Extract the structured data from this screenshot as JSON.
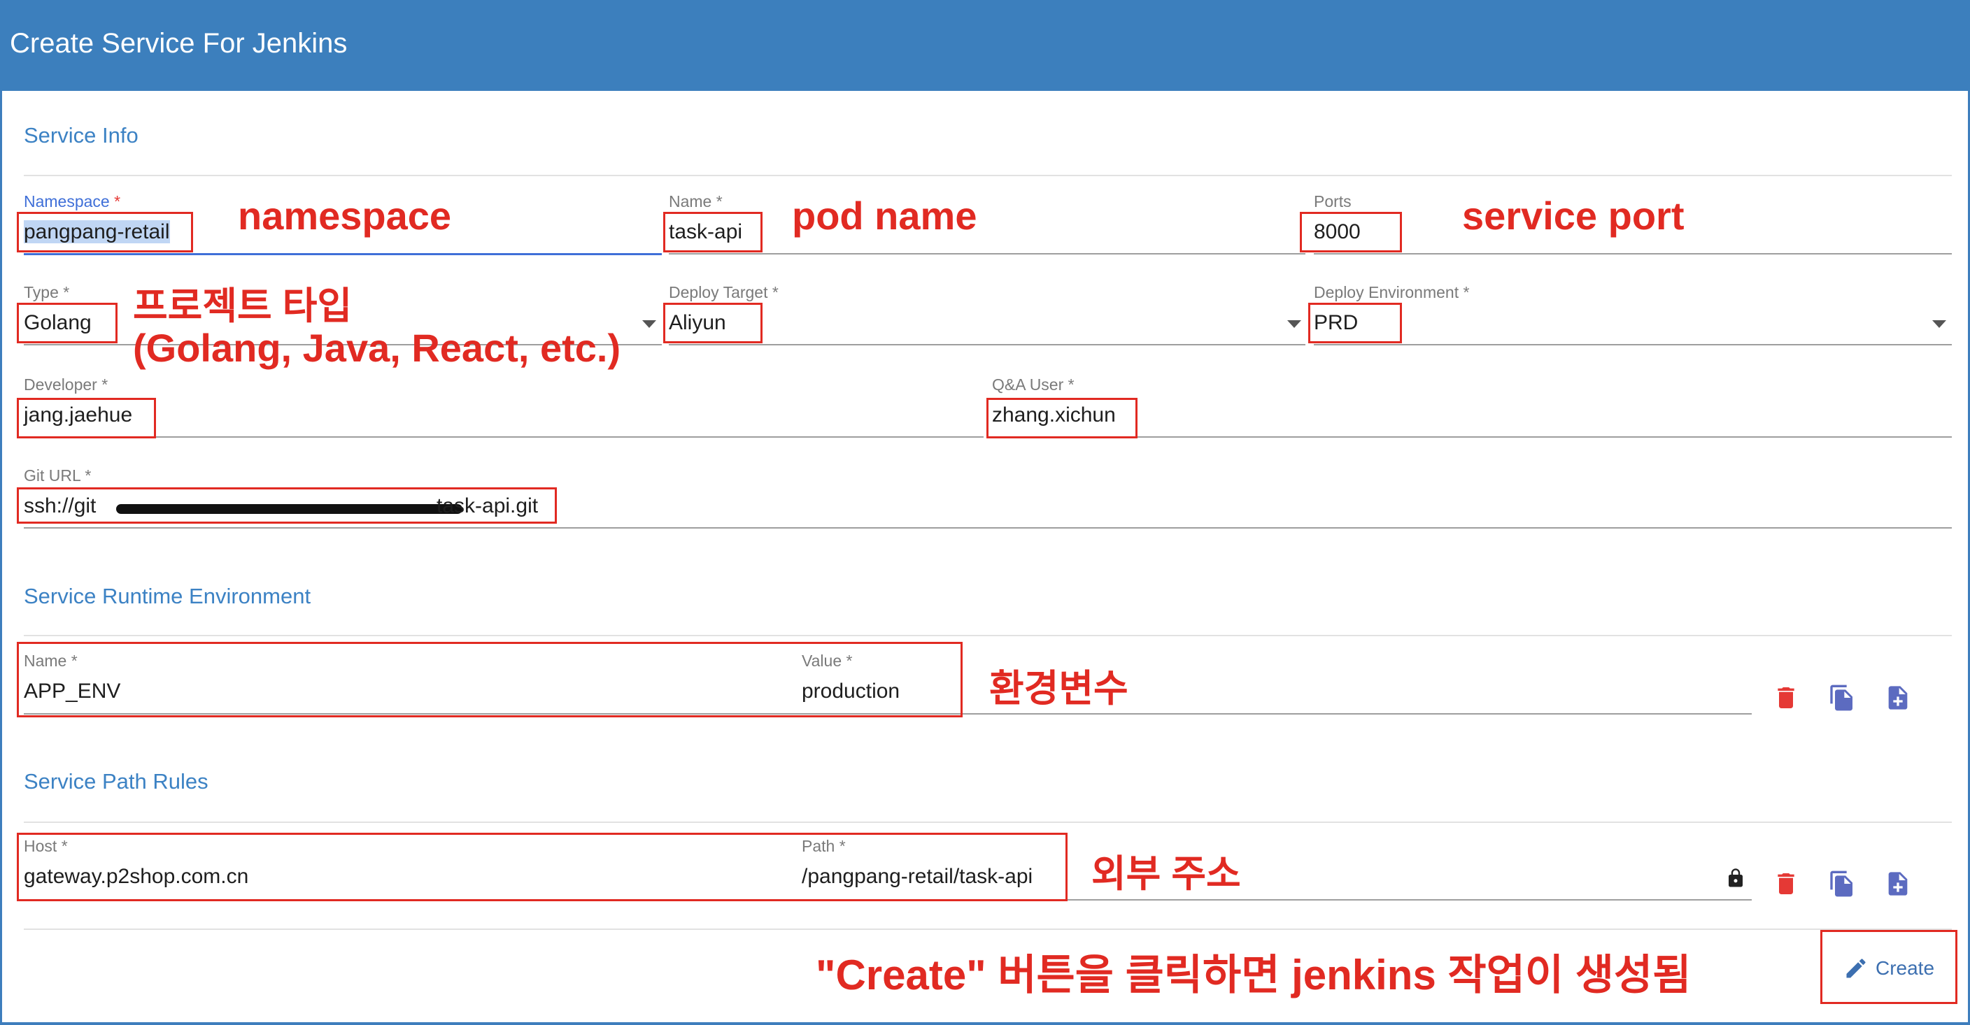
{
  "header": {
    "title": "Create Service For Jenkins"
  },
  "service_info": {
    "section_title": "Service Info",
    "namespace": {
      "label": "Namespace",
      "value": "pangpang-retail"
    },
    "name": {
      "label": "Name",
      "value": "task-api"
    },
    "ports": {
      "label": "Ports",
      "value": "8000"
    },
    "type": {
      "label": "Type",
      "value": "Golang"
    },
    "deploy_target": {
      "label": "Deploy Target",
      "value": "Aliyun"
    },
    "deploy_environment": {
      "label": "Deploy Environment",
      "value": "PRD"
    },
    "developer": {
      "label": "Developer",
      "value": "jang.jaehue"
    },
    "qa_user": {
      "label": "Q&A User",
      "value": "zhang.xichun"
    },
    "git_url": {
      "label": "Git URL",
      "value_start": "ssh://git",
      "value_end": "task-api.git"
    }
  },
  "runtime_env": {
    "section_title": "Service Runtime Environment",
    "name_label": "Name",
    "name_value": "APP_ENV",
    "value_label": "Value",
    "value_value": "production"
  },
  "path_rules": {
    "section_title": "Service Path Rules",
    "host_label": "Host",
    "host_value": "gateway.p2shop.com.cn",
    "path_label": "Path",
    "path_value": "/pangpang-retail/task-api"
  },
  "actions": {
    "create_label": "Create"
  },
  "required_mark": "*",
  "annotations": {
    "namespace": "namespace",
    "pod_name": "pod name",
    "service_port": "service port",
    "project_type_1": "프로젝트 타입",
    "project_type_2": "(Golang, Java, React, etc.)",
    "env_vars": "환경변수",
    "external_address": "외부 주소",
    "create_note": "\"Create\" 버튼을 클릭하면 jenkins 작업이 생성됨"
  },
  "colors": {
    "header": "#3c7fbd",
    "accent": "#3c82c4",
    "annotation": "#e12a22",
    "danger": "#e53935",
    "action_icon": "#5c6bc0"
  },
  "icons": [
    "trash-icon",
    "copy-icon",
    "add-file-icon",
    "lock-icon",
    "pencil-icon"
  ]
}
